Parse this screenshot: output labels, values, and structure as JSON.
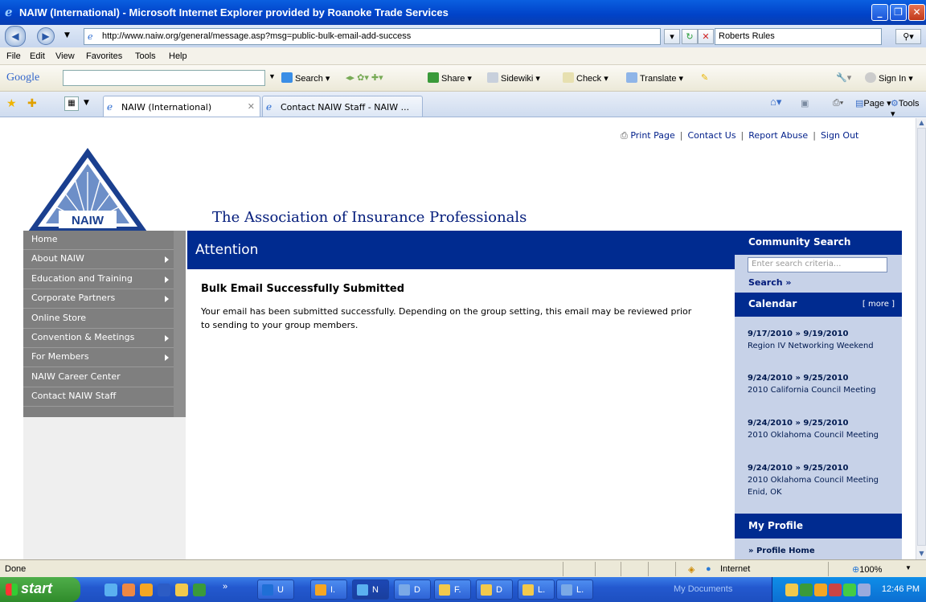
{
  "window": {
    "title": "NAIW (International) - Microsoft Internet Explorer provided by Roanoke Trade Services"
  },
  "address": {
    "url": "http://www.naiw.org/general/message.asp?msg=public-bulk-email-add-success",
    "search_text": "Roberts Rules"
  },
  "menu": [
    "File",
    "Edit",
    "View",
    "Favorites",
    "Tools",
    "Help"
  ],
  "google_bar": {
    "logo": "Google",
    "search": "Search",
    "share": "Share",
    "sidewiki": "Sidewiki",
    "check": "Check",
    "translate": "Translate",
    "sign_in": "Sign In"
  },
  "tabs": [
    {
      "label": "NAIW (International)"
    },
    {
      "label": "Contact NAIW Staff - NAIW ..."
    }
  ],
  "commands": {
    "page": "Page",
    "tools": "Tools"
  },
  "top_links": {
    "print": "Print Page",
    "contact": "Contact Us",
    "abuse": "Report Abuse",
    "signout": "Sign Out"
  },
  "logo_text": "NAIW",
  "tagline": "The Association of Insurance Professionals",
  "nav": [
    {
      "label": "Home",
      "arrow": false
    },
    {
      "label": "About NAIW",
      "arrow": true
    },
    {
      "label": "Education and Training",
      "arrow": true
    },
    {
      "label": "Corporate Partners",
      "arrow": true
    },
    {
      "label": "Online Store",
      "arrow": false
    },
    {
      "label": "Convention & Meetings",
      "arrow": true
    },
    {
      "label": "For Members",
      "arrow": true
    },
    {
      "label": "NAIW Career Center",
      "arrow": false
    },
    {
      "label": "Contact NAIW Staff",
      "arrow": false
    }
  ],
  "main": {
    "header": "Attention",
    "title": "Bulk Email Successfully Submitted",
    "body": "Your email has been submitted successfully. Depending on the group setting, this email may be reviewed prior to sending to your group members."
  },
  "sidebar": {
    "search_title": "Community Search",
    "search_placeholder": "Enter search criteria...",
    "search_link": "Search »",
    "calendar_title": "Calendar",
    "calendar_more": "[ more ]",
    "events": [
      {
        "date": "9/17/2010 » 9/19/2010",
        "name": "Region IV Networking Weekend"
      },
      {
        "date": "9/24/2010 » 9/25/2010",
        "name": "2010 California Council Meeting"
      },
      {
        "date": "9/24/2010 » 9/25/2010",
        "name": "2010 Oklahoma Council Meeting"
      },
      {
        "date": "9/24/2010 » 9/25/2010",
        "name": "2010 Oklahoma Council Meeting Enid, OK"
      }
    ],
    "profile_title": "My Profile",
    "profile_home": "» Profile Home"
  },
  "status": {
    "text": "Done",
    "zone": "Internet",
    "zoom": "100%"
  },
  "taskbar": {
    "start": "start",
    "tasks": [
      {
        "label": "U",
        "color": "#1f6fd6",
        "active": false
      },
      {
        "label": "I.",
        "color": "#f5a623",
        "active": false
      },
      {
        "label": "N",
        "color": "#5ab0f0",
        "active": true
      },
      {
        "label": "D",
        "color": "#7aa9e6",
        "active": false
      },
      {
        "label": "F.",
        "color": "#f2c94c",
        "active": false
      },
      {
        "label": "D",
        "color": "#f2c94c",
        "active": false
      },
      {
        "label": "L.",
        "color": "#f2c94c",
        "active": false
      },
      {
        "label": "L.",
        "color": "#7aa9e6",
        "active": false
      }
    ],
    "my_documents": "My Documents",
    "clock": "12:46 PM"
  }
}
